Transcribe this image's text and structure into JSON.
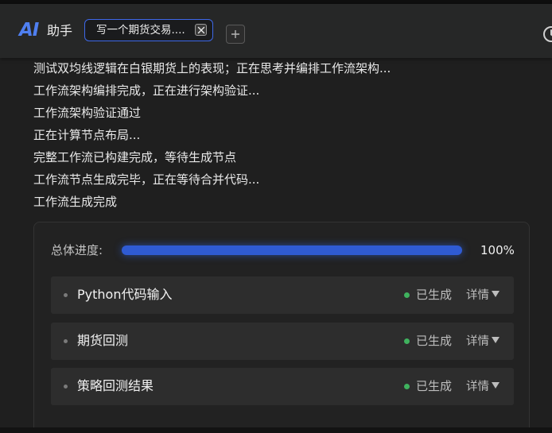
{
  "header": {
    "logo_text": "AI",
    "title": "助手",
    "tab_label": "写一个期货交易....",
    "accent_color": "#3e68e8"
  },
  "log": {
    "lines": [
      "测试双均线逻辑在白银期货上的表现；正在思考并编排工作流架构...",
      "工作流架构编排完成，正在进行架构验证...",
      "工作流架构验证通过",
      "正在计算节点布局...",
      "完整工作流已构建完成，等待生成节点",
      "工作流节点生成完毕，正在等待合并代码...",
      "工作流生成完成"
    ]
  },
  "progress": {
    "label": "总体进度:",
    "percent": 100,
    "value_text": "100%",
    "fill_color": "#2f5bd3"
  },
  "nodes": [
    {
      "name": "Python代码输入",
      "status": "已生成",
      "detail_label": "详情"
    },
    {
      "name": "期货回测",
      "status": "已生成",
      "detail_label": "详情"
    },
    {
      "name": "策略回测结果",
      "status": "已生成",
      "detail_label": "详情"
    }
  ],
  "status_color": "#3fb25e"
}
